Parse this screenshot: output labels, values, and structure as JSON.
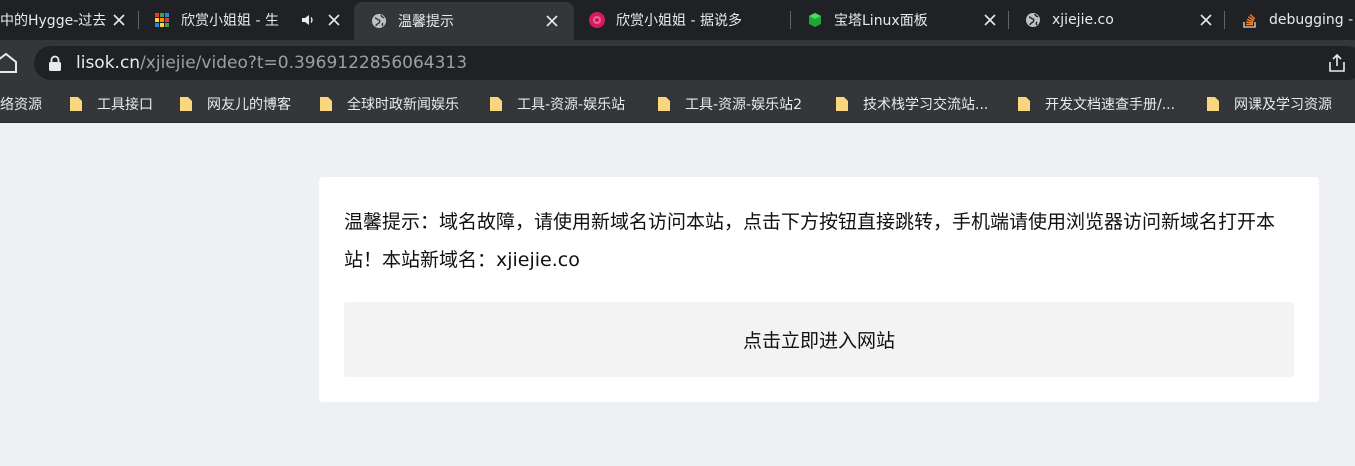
{
  "tabs": [
    {
      "title": "中的Hygge-过去",
      "icon": "page-icon",
      "active": false
    },
    {
      "title": "欣赏小姐姐 - 生",
      "icon": "rubik-cube-icon",
      "active": false,
      "audio": true
    },
    {
      "title": "温馨提示",
      "icon": "globe-icon",
      "active": true
    },
    {
      "title": "欣赏小姐姐 - 据说多",
      "icon": "pink-flower-icon",
      "active": false
    },
    {
      "title": "宝塔Linux面板",
      "icon": "bt-panel-icon",
      "active": false
    },
    {
      "title": "xjiejie.co",
      "icon": "globe-icon",
      "active": false
    },
    {
      "title": "debugging -",
      "icon": "stackoverflow-icon",
      "active": false
    }
  ],
  "address_bar": {
    "host": "lisok.cn",
    "path": "/xjiejie/video?t=0.3969122856064313"
  },
  "bookmarks": [
    "络资源",
    "工具接口",
    "网友儿的博客",
    "全球时政新闻娱乐",
    "工具-资源-娱乐站",
    "工具-资源-娱乐站2",
    "技术栈学习交流站...",
    "开发文档速查手册/...",
    "网课及学习资源"
  ],
  "page": {
    "notice": "温馨提示：域名故障，请使用新域名访问本站，点击下方按钮直接跳转，手机端请使用浏览器访问新域名打开本站！本站新域名：xjiejie.co",
    "button_label": "点击立即进入网站"
  },
  "colors": {
    "tabstrip_bg": "#202124",
    "toolbar_bg": "#35363a",
    "page_bg": "#eef0f3",
    "card_bg": "#ffffff",
    "button_bg": "#f3f3f3",
    "folder_color": "#f9d77e"
  }
}
